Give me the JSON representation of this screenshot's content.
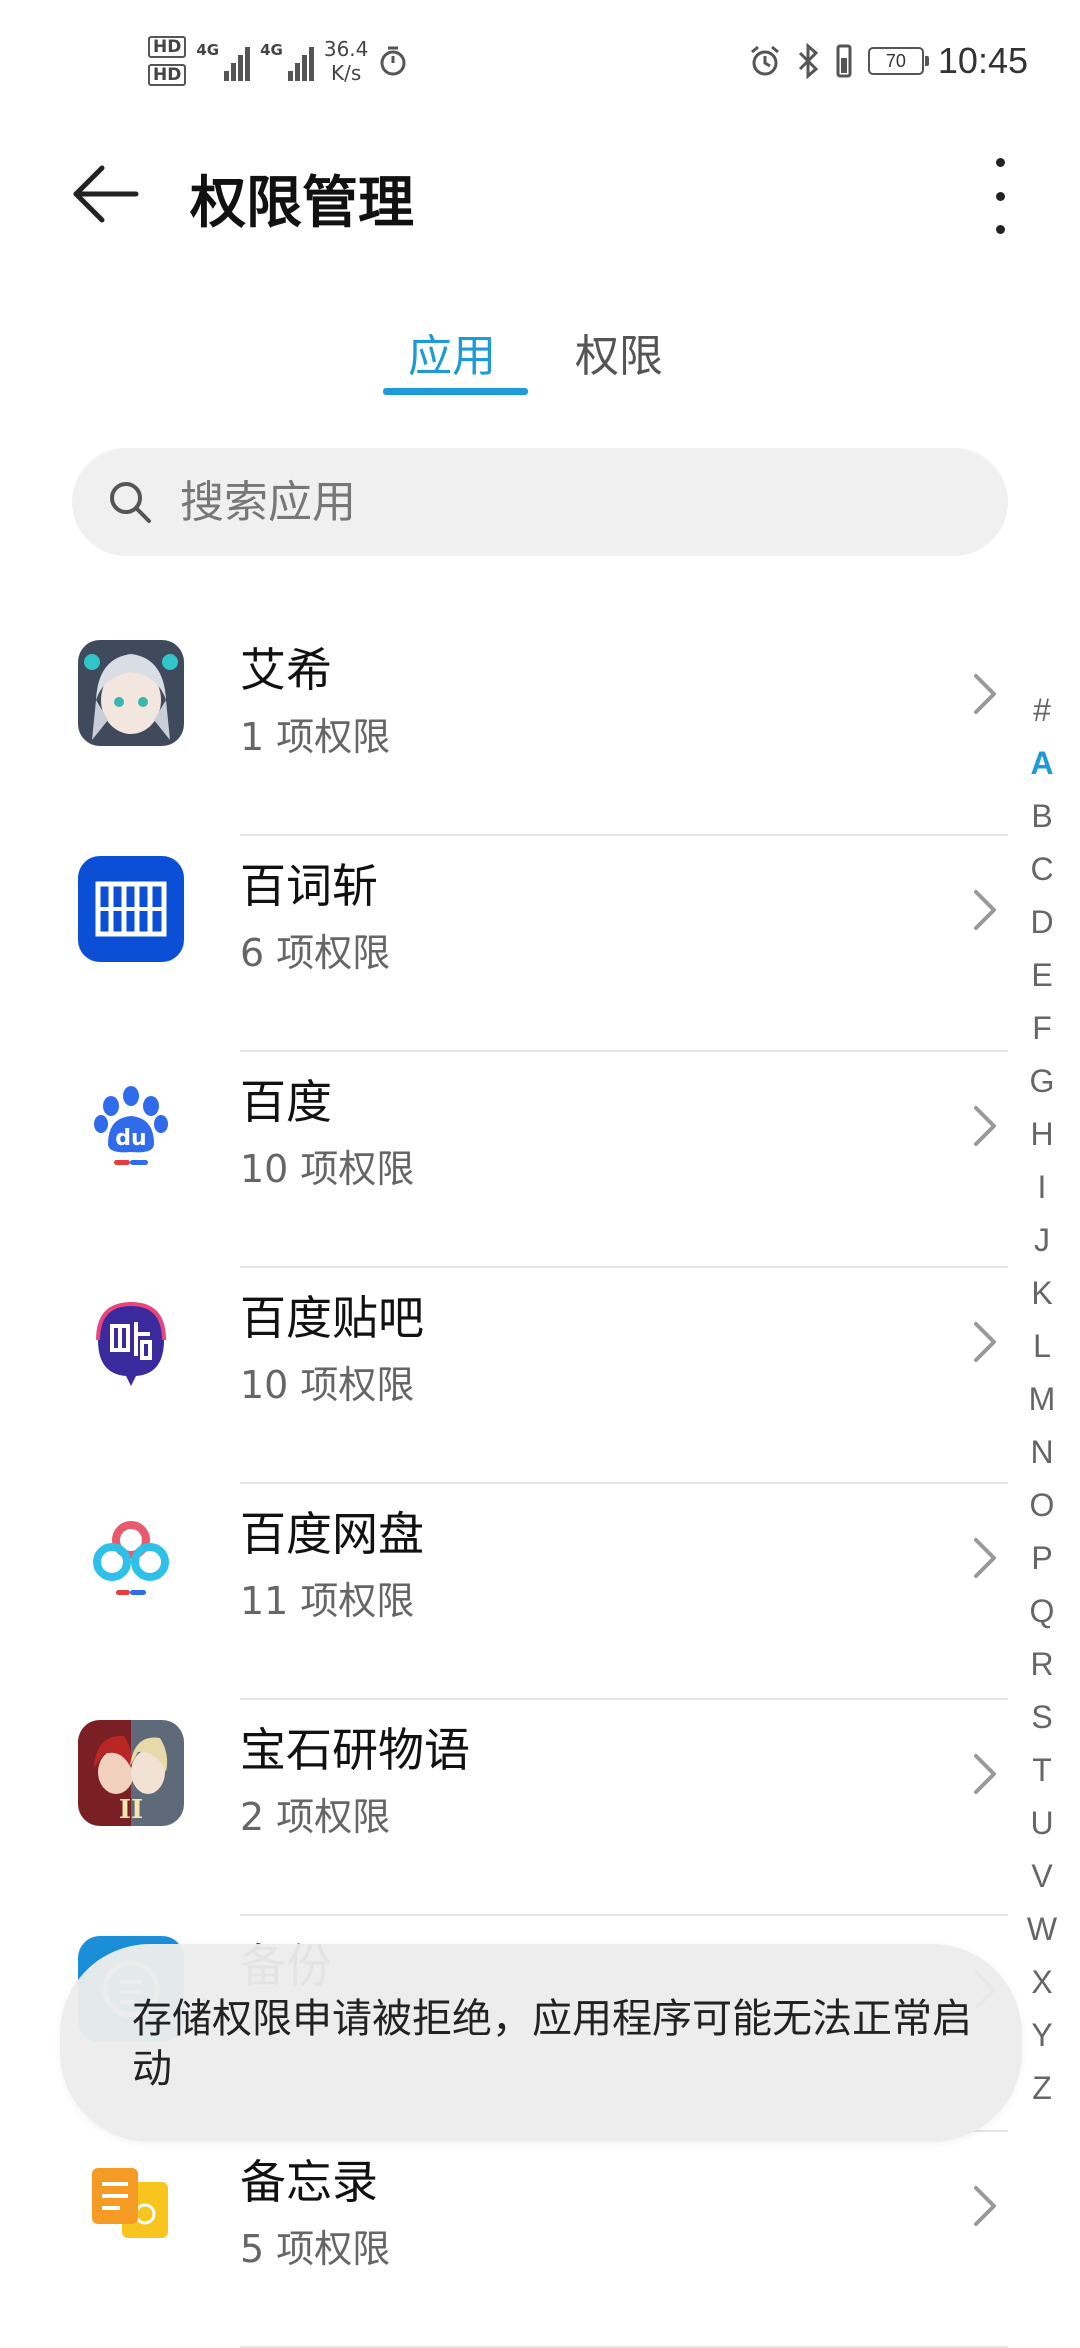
{
  "status_bar": {
    "hd1": "HD",
    "hd2": "HD",
    "net1": "4G",
    "net2": "4G",
    "speed_value": "36.4",
    "speed_unit": "K/s",
    "battery": "70",
    "time": "10:45"
  },
  "header": {
    "title": "权限管理"
  },
  "tabs": [
    {
      "label": "应用",
      "active": true
    },
    {
      "label": "权限",
      "active": false
    }
  ],
  "search": {
    "placeholder": "搜索应用"
  },
  "apps": [
    {
      "name": "艾希",
      "permissions": "1 项权限",
      "icon": "aixi-game-icon"
    },
    {
      "name": "百词斩",
      "permissions": "6 项权限",
      "icon": "baicizhan-icon"
    },
    {
      "name": "百度",
      "permissions": "10 项权限",
      "icon": "baidu-paw-icon"
    },
    {
      "name": "百度贴吧",
      "permissions": "10 项权限",
      "icon": "tieba-icon"
    },
    {
      "name": "百度网盘",
      "permissions": "11 项权限",
      "icon": "baidu-netdisk-icon"
    },
    {
      "name": "宝石研物语",
      "permissions": "2 项权限",
      "icon": "gem-story-game-icon"
    },
    {
      "name": "备份",
      "permissions": "",
      "icon": "backup-icon"
    },
    {
      "name": "备忘录",
      "permissions": "5 项权限",
      "icon": "notes-icon"
    }
  ],
  "index_letters": [
    "#",
    "A",
    "B",
    "C",
    "D",
    "E",
    "F",
    "G",
    "H",
    "I",
    "J",
    "K",
    "L",
    "M",
    "N",
    "O",
    "P",
    "Q",
    "R",
    "S",
    "T",
    "U",
    "V",
    "W",
    "X",
    "Y",
    "Z"
  ],
  "index_active": "A",
  "toast": {
    "message": "存储权限申请被拒绝，应用程序可能无法正常启动"
  },
  "colors": {
    "accent": "#1e9bd7",
    "baicizhan_blue": "#0a4fd6",
    "baidu_blue": "#2f6bea",
    "baidu_red": "#e73c3c",
    "tieba_purple": "#3a2a9e",
    "notes_orange": "#f59a23"
  }
}
